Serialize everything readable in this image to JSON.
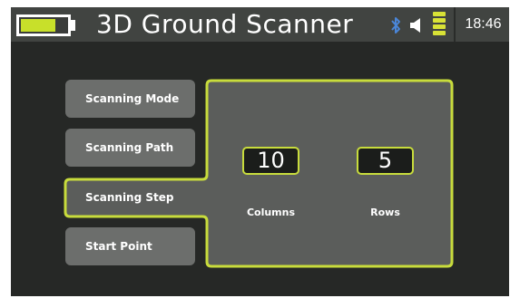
{
  "status_bar": {
    "app_title": "3D Ground Scanner",
    "time": "18:46",
    "battery_level": 0.75,
    "signal_bars": 4,
    "icons": [
      "battery-icon",
      "bluetooth-icon",
      "speaker-icon",
      "signal-icon"
    ]
  },
  "menu": {
    "items": [
      {
        "label": "Scanning Mode",
        "selected": false
      },
      {
        "label": "Scanning Path",
        "selected": false
      },
      {
        "label": "Scanning Step",
        "selected": true
      },
      {
        "label": "Start Point",
        "selected": false
      }
    ]
  },
  "step_panel": {
    "columns": {
      "value": "10",
      "label": "Columns"
    },
    "rows": {
      "value": "5",
      "label": "Rows"
    }
  },
  "colors": {
    "accent": "#c8dc3c",
    "background": "#262826",
    "status_bar": "#414441",
    "button": "#6c6e6c",
    "panel": "#5b5d5b"
  }
}
